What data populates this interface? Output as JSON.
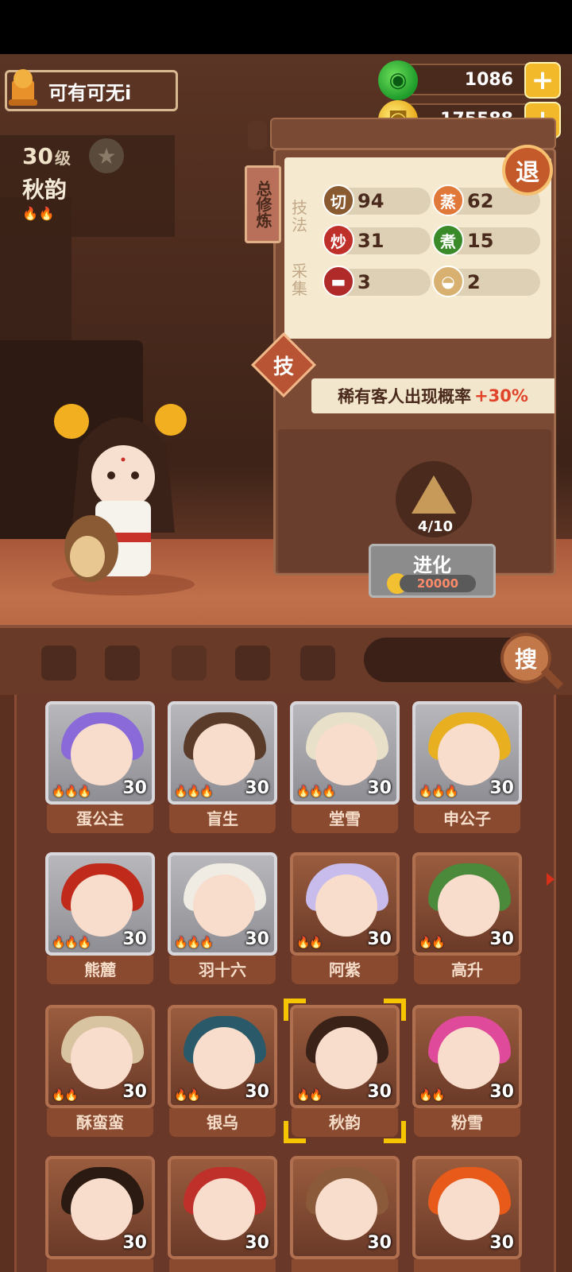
{
  "player": {
    "name": "可有可无i"
  },
  "character": {
    "level": "30",
    "level_unit": "级",
    "name": "秋韵"
  },
  "currency": {
    "jade": "1086",
    "coins": "175588"
  },
  "panel": {
    "tab_label": "总修炼",
    "exit_label": "退",
    "section_technique": "技法",
    "section_gather": "采集",
    "skills": [
      {
        "badge": "切",
        "value": "94",
        "color": "#8a5a30"
      },
      {
        "badge": "蒸",
        "value": "62",
        "color": "#e0783a"
      },
      {
        "badge": "炒",
        "value": "31",
        "color": "#c0302a"
      },
      {
        "badge": "煮",
        "value": "15",
        "color": "#3a8a2a"
      }
    ],
    "gather": [
      {
        "value": "3",
        "color": "#b02a2a"
      },
      {
        "value": "2",
        "color": "#d8b070"
      }
    ],
    "skill_button": "技",
    "rare_bonus_text": "稀有客人出现概率",
    "rare_bonus_pct": "+30%",
    "evolve_count": "4/10",
    "evolve_label": "进化",
    "evolve_cost": "20000"
  },
  "search_label": "搜",
  "roster": [
    {
      "name": "蛋公主",
      "level": "30",
      "flames": "🔥🔥🔥",
      "frame": "silver",
      "hair": "#8a6ad8"
    },
    {
      "name": "盲生",
      "level": "30",
      "flames": "🔥🔥🔥",
      "frame": "silver",
      "hair": "#5a3a28"
    },
    {
      "name": "堂雪",
      "level": "30",
      "flames": "🔥🔥🔥",
      "frame": "silver",
      "hair": "#e8e0c8"
    },
    {
      "name": "申公子",
      "level": "30",
      "flames": "🔥🔥🔥",
      "frame": "silver",
      "hair": "#e8b020"
    },
    {
      "name": "熊麓",
      "level": "30",
      "flames": "🔥🔥🔥",
      "frame": "silver",
      "hair": "#c02a1a"
    },
    {
      "name": "羽十六",
      "level": "30",
      "flames": "🔥🔥🔥",
      "frame": "silver",
      "hair": "#f0ece4"
    },
    {
      "name": "阿紫",
      "level": "30",
      "flames": "🔥🔥",
      "frame": "brown",
      "hair": "#c8bcec"
    },
    {
      "name": "高升",
      "level": "30",
      "flames": "🔥🔥",
      "frame": "brown",
      "hair": "#4a8a3a"
    },
    {
      "name": "酥蛮蛮",
      "level": "30",
      "flames": "🔥🔥",
      "frame": "brown",
      "hair": "#d8c4a0"
    },
    {
      "name": "银乌",
      "level": "30",
      "flames": "🔥🔥",
      "frame": "brown",
      "hair": "#2a5a6a"
    },
    {
      "name": "秋韵",
      "level": "30",
      "flames": "🔥🔥",
      "frame": "brown",
      "hair": "#3a2218"
    },
    {
      "name": "粉雪",
      "level": "30",
      "flames": "🔥🔥",
      "frame": "brown",
      "hair": "#e04a9a"
    },
    {
      "name": "",
      "level": "30",
      "flames": "",
      "frame": "brown",
      "hair": "#2a1a12"
    },
    {
      "name": "",
      "level": "30",
      "flames": "",
      "frame": "brown",
      "hair": "#c0302a"
    },
    {
      "name": "",
      "level": "30",
      "flames": "",
      "frame": "brown",
      "hair": "#8a5a3a"
    },
    {
      "name": "",
      "level": "30",
      "flames": "",
      "frame": "brown",
      "hair": "#e85a1a"
    }
  ]
}
